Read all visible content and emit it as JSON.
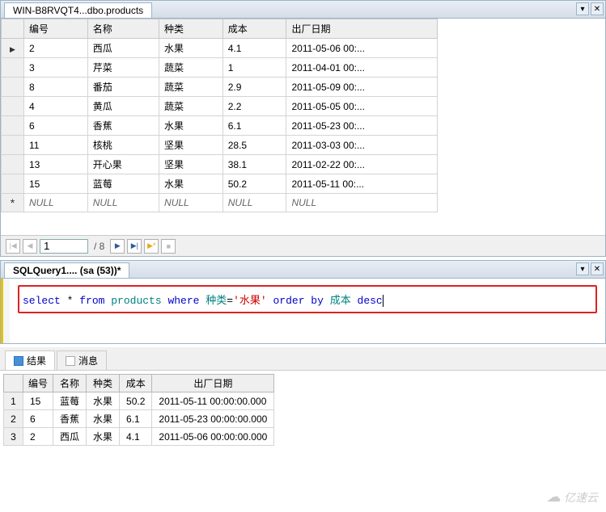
{
  "top_tab": "WIN-B8RVQT4...dbo.products",
  "columns": [
    "编号",
    "名称",
    "种类",
    "成本",
    "出厂日期"
  ],
  "rows": [
    {
      "c0": "2",
      "c1": "西瓜",
      "c2": "水果",
      "c3": "4.1",
      "c4": "2011-05-06 00:..."
    },
    {
      "c0": "3",
      "c1": "芹菜",
      "c2": "蔬菜",
      "c3": "1",
      "c4": "2011-04-01 00:..."
    },
    {
      "c0": "8",
      "c1": "番茄",
      "c2": "蔬菜",
      "c3": "2.9",
      "c4": "2011-05-09 00:..."
    },
    {
      "c0": "4",
      "c1": "黄瓜",
      "c2": "蔬菜",
      "c3": "2.2",
      "c4": "2011-05-05 00:..."
    },
    {
      "c0": "6",
      "c1": "香蕉",
      "c2": "水果",
      "c3": "6.1",
      "c4": "2011-05-23 00:..."
    },
    {
      "c0": "11",
      "c1": "核桃",
      "c2": "坚果",
      "c3": "28.5",
      "c4": "2011-03-03 00:..."
    },
    {
      "c0": "13",
      "c1": "开心果",
      "c2": "坚果",
      "c3": "38.1",
      "c4": "2011-02-22 00:..."
    },
    {
      "c0": "15",
      "c1": "蓝莓",
      "c2": "水果",
      "c3": "50.2",
      "c4": "2011-05-11 00:..."
    }
  ],
  "null_text": "NULL",
  "nav": {
    "pos": "1",
    "total": "/ 8"
  },
  "sql_tab": "SQLQuery1.... (sa (53))*",
  "sql": {
    "p1": "select",
    "p2": " * ",
    "p3": "from",
    "p4": " products ",
    "p5": "where",
    "p6": " 种类",
    "p7": "=",
    "p8": "'水果'",
    "p9": " order by ",
    "p10": "成本 ",
    "p11": "desc"
  },
  "result_tabs": {
    "results": "结果",
    "messages": "消息"
  },
  "result_columns": [
    "编号",
    "名称",
    "种类",
    "成本",
    "出厂日期"
  ],
  "result_rows": [
    {
      "n": "1",
      "c0": "15",
      "c1": "蓝莓",
      "c2": "水果",
      "c3": "50.2",
      "c4": "2011-05-11 00:00:00.000"
    },
    {
      "n": "2",
      "c0": "6",
      "c1": "香蕉",
      "c2": "水果",
      "c3": "6.1",
      "c4": "2011-05-23 00:00:00.000"
    },
    {
      "n": "3",
      "c0": "2",
      "c1": "西瓜",
      "c2": "水果",
      "c3": "4.1",
      "c4": "2011-05-06 00:00:00.000"
    }
  ],
  "watermark": "亿速云"
}
